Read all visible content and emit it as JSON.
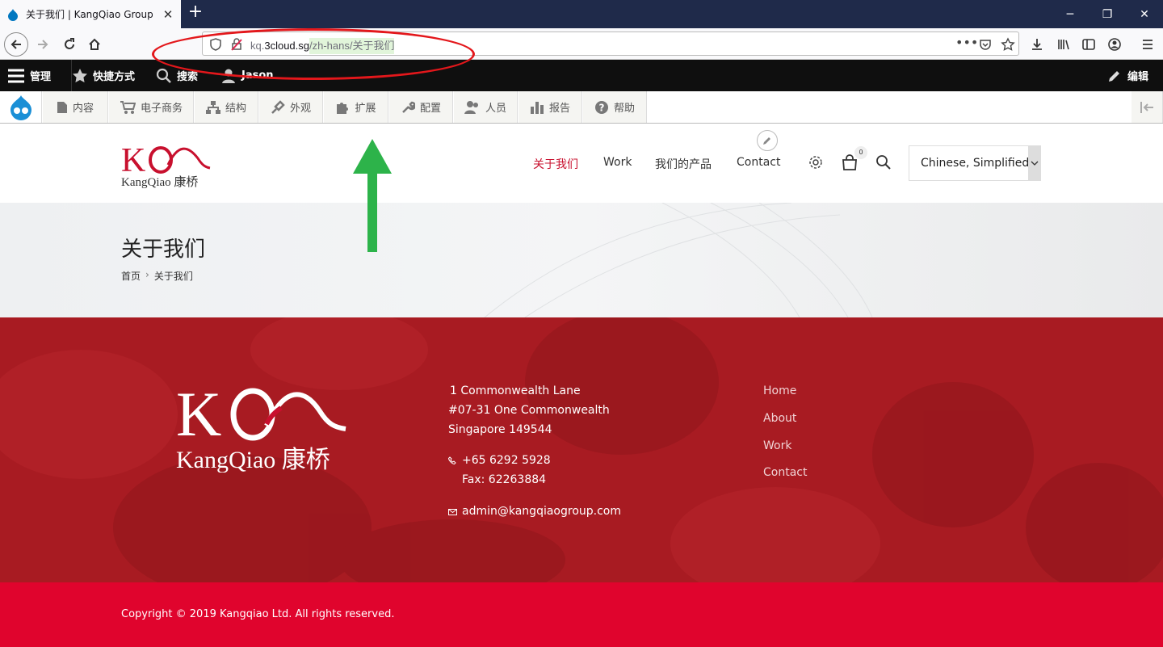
{
  "browser": {
    "tab_title": "关于我们 | KangQiao Group",
    "url_domain_prefix": "kq.",
    "url_domain": "3cloud.sg",
    "url_path": "/zh-hans/关于我们"
  },
  "admin_toolbar": {
    "manage": "管理",
    "shortcuts": "快捷方式",
    "search": "搜索",
    "user": "Jason",
    "edit": "编辑",
    "tray_items": [
      "内容",
      "电子商务",
      "结构",
      "外观",
      "扩展",
      "配置",
      "人员",
      "报告",
      "帮助"
    ]
  },
  "site_nav": {
    "items": [
      "关于我们",
      "Work",
      "我们的产品",
      "Contact"
    ],
    "active_index": 0,
    "cart_count": "0",
    "language": "Chinese, Simplified"
  },
  "banner": {
    "title": "关于我们",
    "breadcrumb_home": "首页",
    "breadcrumb_sep": "›",
    "breadcrumb_current": "关于我们"
  },
  "footer": {
    "address_line1": "1 Commonwealth Lane",
    "address_line2": "#07-31 One Commonwealth",
    "address_line3": "Singapore 149544",
    "phone": "+65 6292 5928",
    "fax": "Fax: 62263884",
    "email": "admin@kangqiaogroup.com",
    "links": [
      "Home",
      "About",
      "Work",
      "Contact"
    ],
    "copyright": "Copyright © 2019 Kangqiao Ltd. All rights reserved."
  },
  "colors": {
    "brand_red": "#c8102e",
    "footer_red": "#a81b22",
    "copyright_red": "#e0042d",
    "annotation_green": "#2db34a"
  }
}
